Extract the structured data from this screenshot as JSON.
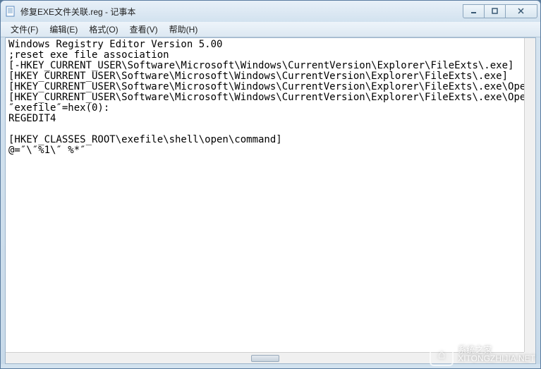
{
  "window": {
    "title": "修复EXE文件关联.reg - 记事本"
  },
  "menu": {
    "file": "文件(F)",
    "edit": "编辑(E)",
    "format": "格式(O)",
    "view": "查看(V)",
    "help": "帮助(H)"
  },
  "content": {
    "lines": [
      "Windows Registry Editor Version 5.00",
      ";reset exe file association",
      "[-HKEY_CURRENT_USER\\Software\\Microsoft\\Windows\\CurrentVersion\\Explorer\\FileExts\\.exe]",
      "[HKEY_CURRENT_USER\\Software\\Microsoft\\Windows\\CurrentVersion\\Explorer\\FileExts\\.exe]",
      "[HKEY_CURRENT_USER\\Software\\Microsoft\\Windows\\CurrentVersion\\Explorer\\FileExts\\.exe\\OpenWit",
      "[HKEY_CURRENT_USER\\Software\\Microsoft\\Windows\\CurrentVersion\\Explorer\\FileExts\\.exe\\OpenWit",
      "″exefile″=hex(0):",
      "REGEDIT4",
      "",
      "[HKEY_CLASSES_ROOT\\exefile\\shell\\open\\command]",
      "@=″\\″%1\\″ %*″"
    ]
  },
  "watermark": {
    "line1": "系统之家",
    "line2": "XITONGZHIJIA.NET"
  }
}
